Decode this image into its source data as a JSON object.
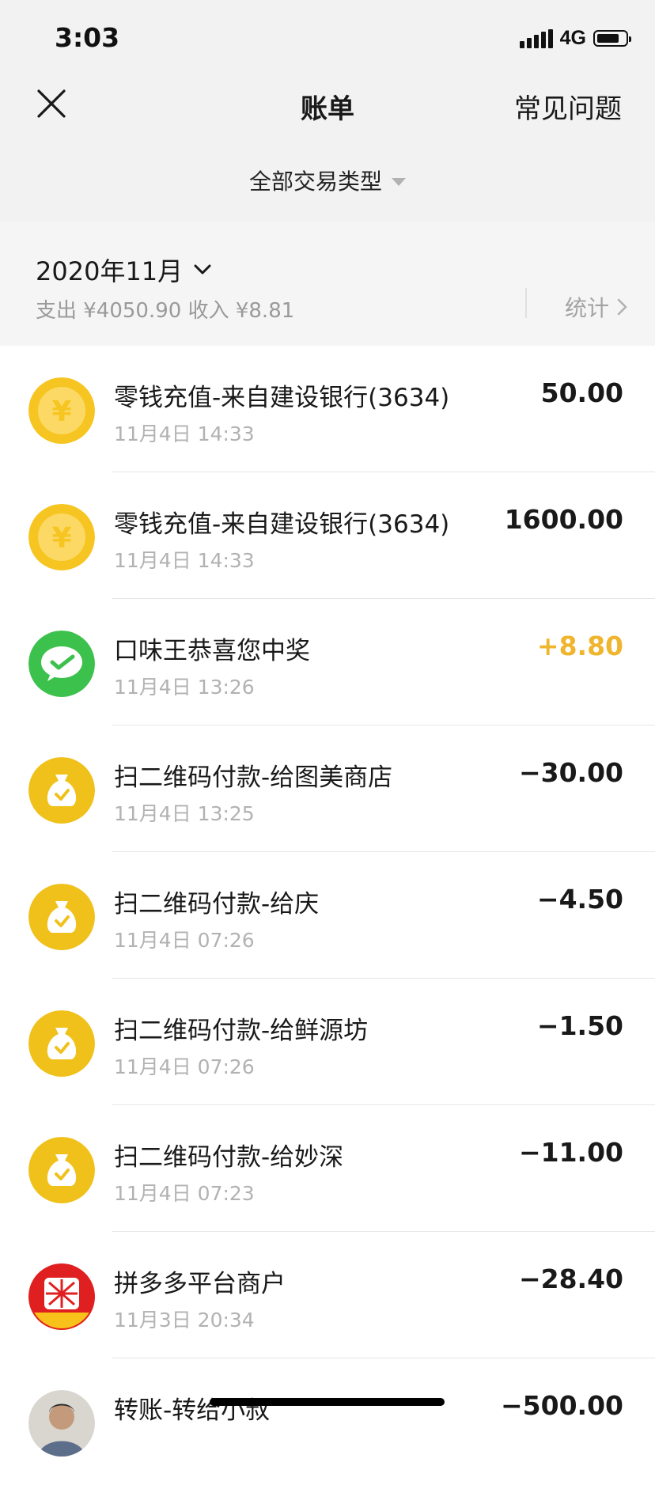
{
  "status": {
    "time": "3:03",
    "network": "4G",
    "battery_level": 0.8
  },
  "nav": {
    "title": "账单",
    "faq_label": "常见问题"
  },
  "filter": {
    "label": "全部交易类型"
  },
  "month": {
    "label": "2020年11月",
    "summary": "支出 ¥4050.90 收入 ¥8.81",
    "stats_label": "统计"
  },
  "colors": {
    "income": "#f0b52e",
    "coin": "#f6c521",
    "wechat_green": "#3dc14d",
    "pdd_red": "#e02020"
  },
  "transactions": [
    {
      "icon": "yuan-coin-icon",
      "title": "零钱充值-来自建设银行(3634)",
      "time": "11月4日 14:33",
      "amount": "50.00",
      "type": "neutral"
    },
    {
      "icon": "yuan-coin-icon",
      "title": "零钱充值-来自建设银行(3634)",
      "time": "11月4日 14:33",
      "amount": "1600.00",
      "type": "neutral"
    },
    {
      "icon": "wechat-pay-icon",
      "title": "口味王恭喜您中奖",
      "time": "11月4日 13:26",
      "amount": "+8.80",
      "type": "income"
    },
    {
      "icon": "money-bag-icon",
      "title": "扫二维码付款-给图美商店",
      "time": "11月4日 13:25",
      "amount": "−30.00",
      "type": "expense"
    },
    {
      "icon": "money-bag-icon",
      "title": "扫二维码付款-给庆",
      "time": "11月4日 07:26",
      "amount": "−4.50",
      "type": "expense"
    },
    {
      "icon": "money-bag-icon",
      "title": "扫二维码付款-给鲜源坊",
      "time": "11月4日 07:26",
      "amount": "−1.50",
      "type": "expense"
    },
    {
      "icon": "money-bag-icon",
      "title": "扫二维码付款-给妙深",
      "time": "11月4日 07:23",
      "amount": "−11.00",
      "type": "expense"
    },
    {
      "icon": "pinduoduo-logo-icon",
      "title": "拼多多平台商户",
      "time": "11月3日 20:34",
      "amount": "−28.40",
      "type": "expense"
    },
    {
      "icon": "user-avatar-icon",
      "title": "转账-转给小叔",
      "time": "",
      "amount": "−500.00",
      "type": "expense"
    }
  ]
}
